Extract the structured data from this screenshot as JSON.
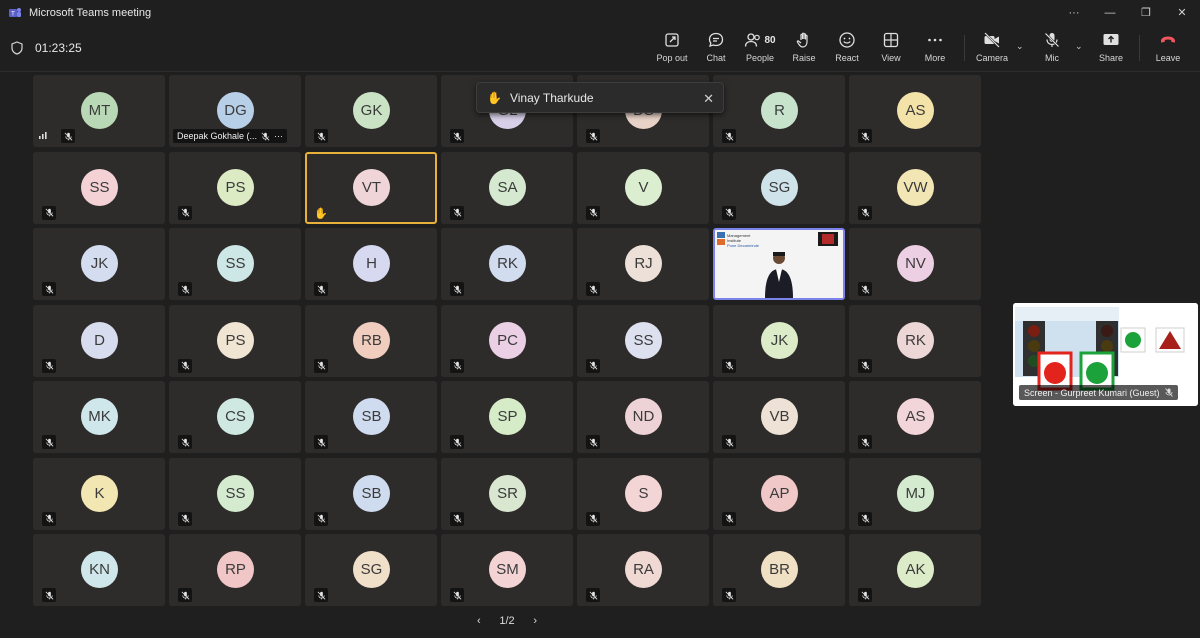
{
  "window": {
    "title": "Microsoft Teams meeting",
    "more": "···",
    "minimize": "—",
    "maximize": "❐",
    "close": "✕"
  },
  "meeting": {
    "timer": "01:23:25"
  },
  "toolbar": {
    "popout": "Pop out",
    "chat": "Chat",
    "people": "People",
    "people_count": "80",
    "raise": "Raise",
    "react": "React",
    "view": "View",
    "more": "More",
    "camera": "Camera",
    "mic": "Mic",
    "share": "Share",
    "leave": "Leave"
  },
  "notification": {
    "name": "Vinay Tharkude",
    "close": "✕"
  },
  "grid": {
    "rows": [
      [
        {
          "i": "MT",
          "c": "#b9d8b5"
        },
        {
          "i": "DG",
          "c": "#b8cfe8"
        },
        {
          "i": "GK",
          "c": "#c9e3c4"
        },
        {
          "i": "GL",
          "c": "#d8d0e8"
        },
        {
          "i": "DS",
          "c": "#e8d3c8"
        },
        {
          "i": "R",
          "c": "#c8e3cc"
        },
        {
          "i": "AS",
          "c": "#f4e3a8"
        }
      ],
      [
        {
          "i": "SS",
          "c": "#f3d1d4"
        },
        {
          "i": "PS",
          "c": "#dcebc4"
        },
        {
          "i": "VT",
          "c": "#f0d5d8"
        },
        {
          "i": "SA",
          "c": "#d4e9cf"
        },
        {
          "i": "V",
          "c": "#dceed0"
        },
        {
          "i": "SG",
          "c": "#cfe3ea"
        },
        {
          "i": "VW",
          "c": "#f3e6b5"
        }
      ],
      [
        {
          "i": "JK",
          "c": "#d4dcef"
        },
        {
          "i": "SS",
          "c": "#cde7e6"
        },
        {
          "i": "H",
          "c": "#d6d9ef"
        },
        {
          "i": "RK",
          "c": "#d1dcef"
        },
        {
          "i": "RJ",
          "c": "#ede0d9"
        },
        {
          "i": "",
          "c": ""
        },
        {
          "i": "NV",
          "c": "#eccfe3"
        }
      ],
      [
        {
          "i": "D",
          "c": "#d8dcef"
        },
        {
          "i": "PS",
          "c": "#f0e4d3"
        },
        {
          "i": "RB",
          "c": "#f0cdbf"
        },
        {
          "i": "PC",
          "c": "#ebcfe4"
        },
        {
          "i": "SS",
          "c": "#dde0ef"
        },
        {
          "i": "JK",
          "c": "#dcecc9"
        },
        {
          "i": "RK",
          "c": "#edd6d6"
        }
      ],
      [
        {
          "i": "MK",
          "c": "#cfe6ea"
        },
        {
          "i": "CS",
          "c": "#cfe8e2"
        },
        {
          "i": "SB",
          "c": "#cfdcef"
        },
        {
          "i": "SP",
          "c": "#d6ecc9"
        },
        {
          "i": "ND",
          "c": "#edd3d6"
        },
        {
          "i": "VB",
          "c": "#eee2d6"
        },
        {
          "i": "AS",
          "c": "#f2d5d8"
        }
      ],
      [
        {
          "i": "K",
          "c": "#f2e6b3"
        },
        {
          "i": "SS",
          "c": "#d4ebd0"
        },
        {
          "i": "SB",
          "c": "#cfdcef"
        },
        {
          "i": "SR",
          "c": "#d9e6d0"
        },
        {
          "i": "S",
          "c": "#f3d5d5"
        },
        {
          "i": "AP",
          "c": "#f0c8c8"
        },
        {
          "i": "MJ",
          "c": "#d4ebcf"
        }
      ],
      [
        {
          "i": "KN",
          "c": "#cfe6ea"
        },
        {
          "i": "RP",
          "c": "#f0c6c6"
        },
        {
          "i": "SG",
          "c": "#f0dfc9"
        },
        {
          "i": "SM",
          "c": "#f3d3d3"
        },
        {
          "i": "RA",
          "c": "#f0d8d3"
        },
        {
          "i": "BR",
          "c": "#f0e0c4"
        },
        {
          "i": "AK",
          "c": "#dcecc9"
        }
      ]
    ],
    "named_tile": {
      "name": "Deepak Gokhale (...",
      "more": "···"
    },
    "screen_tile_text": {
      "line1": "Management",
      "line2": "Institute",
      "line3": "Pune Decamrinde"
    }
  },
  "screen_share": {
    "caption": "Screen - Gurpreet Kumari (Guest)"
  },
  "pager": {
    "prev": "‹",
    "label": "1/2",
    "next": "›"
  },
  "colors": {
    "leave": "#f0565e",
    "raised_hand": "#f5b941",
    "speaking_border": "#e8b23a",
    "screen_border": "#7b83eb"
  }
}
